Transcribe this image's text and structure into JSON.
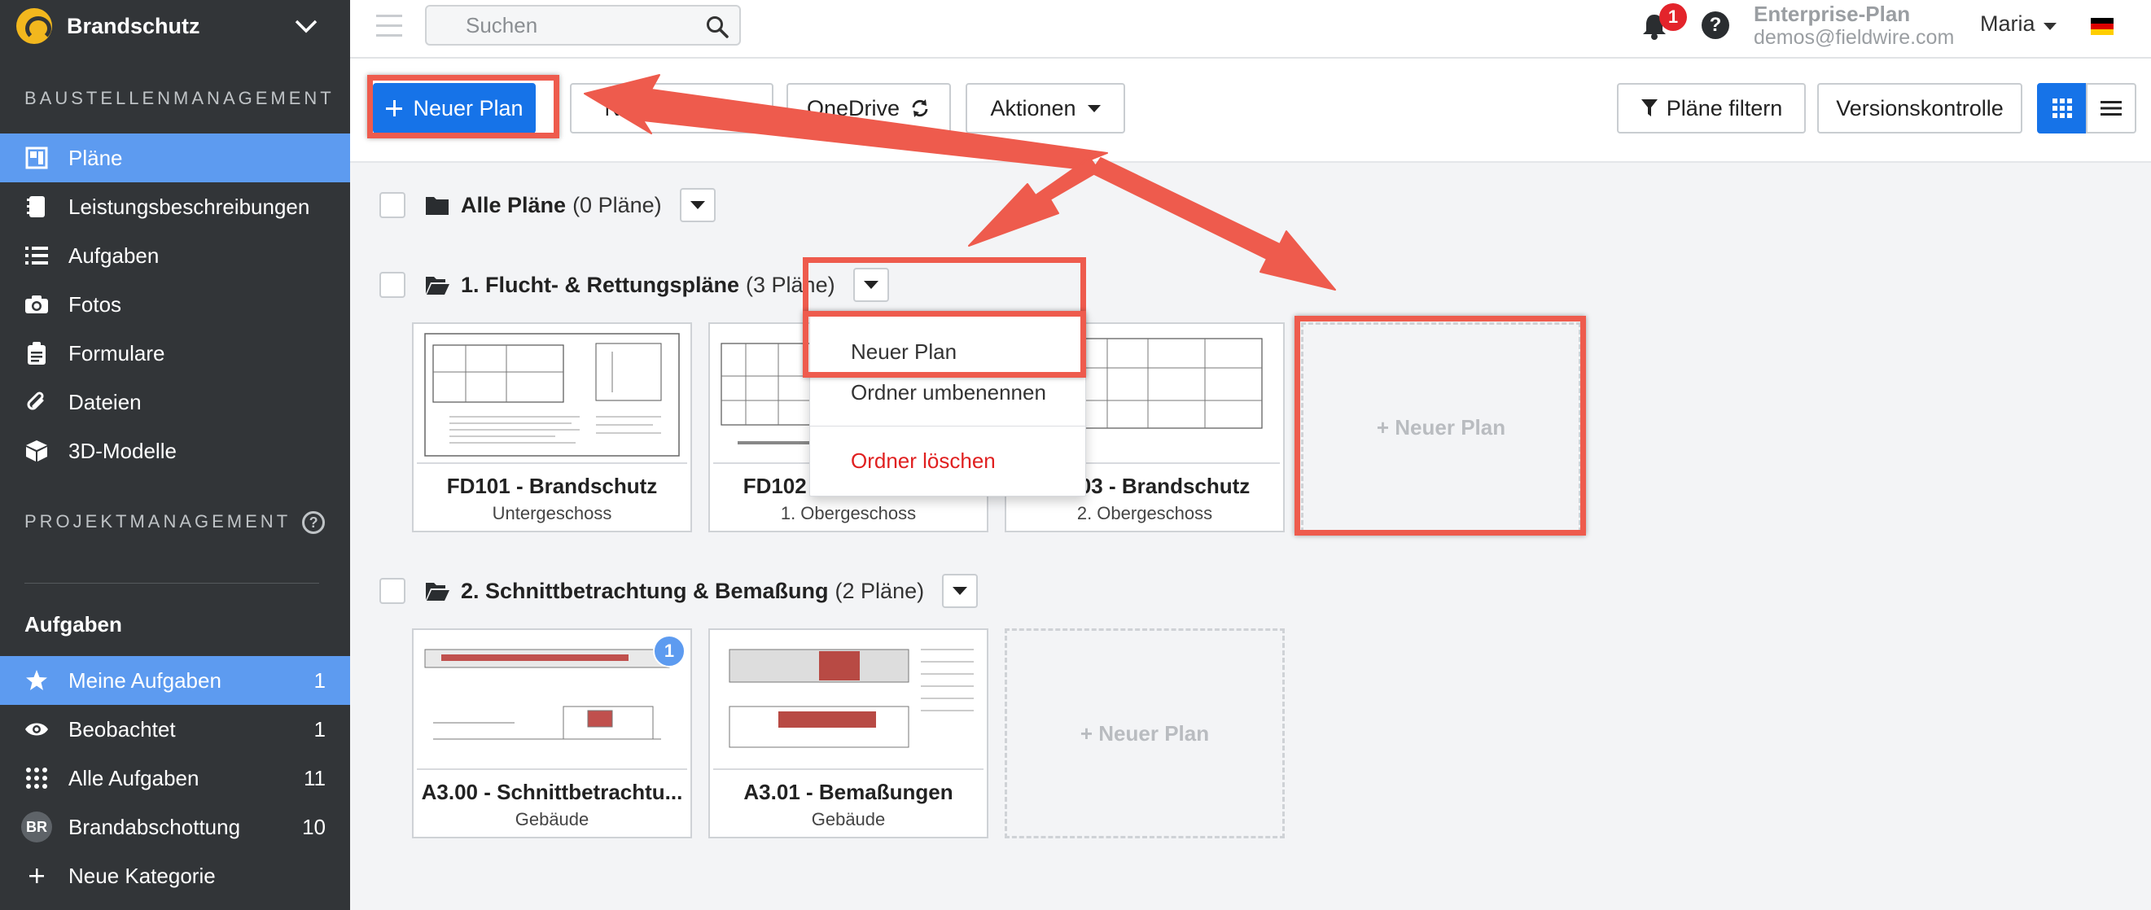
{
  "sidebar": {
    "project": "Brandschutz",
    "section1": "BAUSTELLENMANAGEMENT",
    "nav": [
      {
        "label": "Pläne",
        "icon": "plans-icon"
      },
      {
        "label": "Leistungsbeschreibungen",
        "icon": "specifications-icon"
      },
      {
        "label": "Aufgaben",
        "icon": "tasks-list-icon"
      },
      {
        "label": "Fotos",
        "icon": "camera-icon"
      },
      {
        "label": "Formulare",
        "icon": "forms-icon"
      },
      {
        "label": "Dateien",
        "icon": "paperclip-icon"
      },
      {
        "label": "3D-Modelle",
        "icon": "cube-icon"
      }
    ],
    "section2": "PROJEKTMANAGEMENT",
    "section2_help": "?",
    "tasks_header": "Aufgaben",
    "task_items": [
      {
        "label": "Meine Aufgaben",
        "count": "1",
        "icon": "star-icon"
      },
      {
        "label": "Beobachtet",
        "count": "1",
        "icon": "eye-icon"
      },
      {
        "label": "Alle Aufgaben",
        "count": "11",
        "icon": "grid-dots-icon"
      },
      {
        "label": "Brandabschottung",
        "count": "10",
        "avatar": "BR"
      },
      {
        "label": "Neue Kategorie",
        "count": "",
        "icon": "plus-icon"
      }
    ]
  },
  "topbar": {
    "search_placeholder": "Suchen",
    "notifications": "1",
    "help": "?",
    "plan_name": "Enterprise-Plan",
    "email": "demos@fieldwire.com",
    "user": "Maria"
  },
  "toolbar": {
    "new_plan": "Neuer Plan",
    "new_folder": "Neuer Ordner",
    "onedrive": "OneDrive",
    "actions": "Aktionen",
    "filter": "Pläne filtern",
    "version_control": "Versionskontrolle"
  },
  "folders": [
    {
      "title": "Alle Pläne",
      "count": "(0 Pläne)"
    },
    {
      "title": "1. Flucht- & Rettungspläne",
      "count": "(3 Pläne)",
      "plans": [
        {
          "title": "FD101 - Brandschutz",
          "sub": "Untergeschoss"
        },
        {
          "title": "FD102 - Brandschutz",
          "sub": "1. Obergeschoss"
        },
        {
          "title": "FD103 - Brandschutz",
          "sub": "2. Obergeschoss"
        }
      ]
    },
    {
      "title": "2. Schnittbetrachtung & Bemaßung",
      "count": "(2 Pläne)",
      "plans": [
        {
          "title": "A3.00 - Schnittbetrachtu...",
          "sub": "Gebäude",
          "badge": "1"
        },
        {
          "title": "A3.01 - Bemaßungen",
          "sub": "Gebäude"
        }
      ]
    }
  ],
  "new_plan_card": "+ Neuer Plan",
  "dropdown": {
    "new_plan": "Neuer Plan",
    "rename": "Ordner umbenennen",
    "delete": "Ordner löschen"
  },
  "colors": {
    "primary": "#1673e8",
    "sidebar": "#323538",
    "active": "#5d9bf0",
    "annotation": "#ee5b4d",
    "danger": "#e02020"
  }
}
